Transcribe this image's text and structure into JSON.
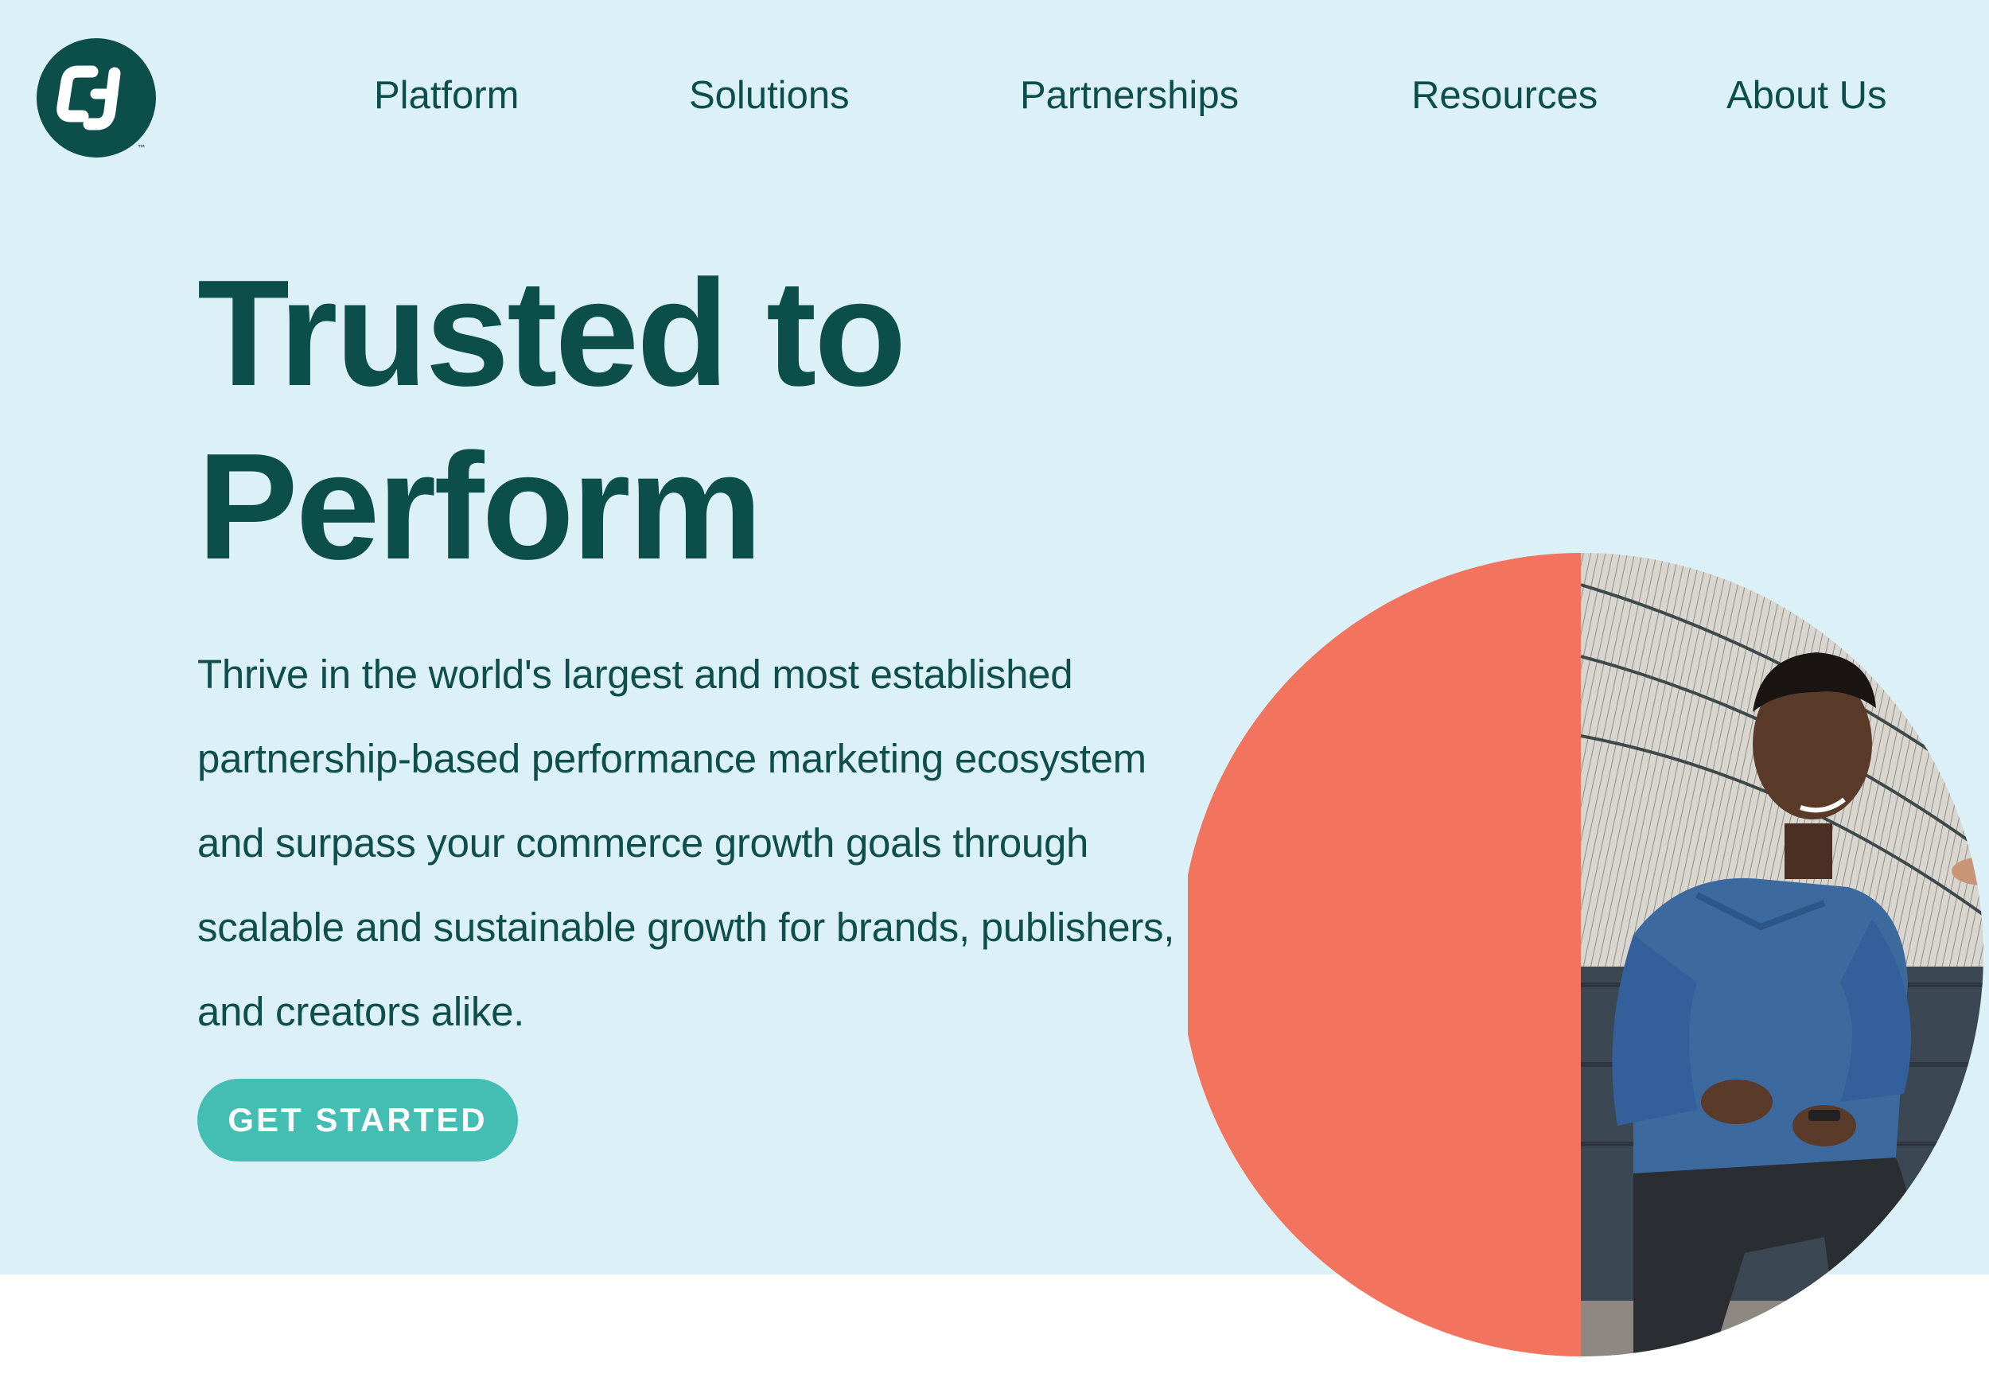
{
  "brand": {
    "logo_alt": "CJ",
    "trademark": "™",
    "color_primary": "#0b4e4a",
    "color_accent": "#44bdb3",
    "color_coral": "#f2745e",
    "color_hero_bg": "#dcf0f8"
  },
  "nav": {
    "items": [
      {
        "label": "Platform"
      },
      {
        "label": "Solutions"
      },
      {
        "label": "Partnerships"
      },
      {
        "label": "Resources"
      },
      {
        "label": "About Us"
      }
    ]
  },
  "hero": {
    "headline_lines": [
      "Trusted to",
      "Perform"
    ],
    "body_lines": [
      "Thrive in the world's largest and most established",
      "partnership-based performance marketing ecosystem",
      "and surpass your commerce growth goals through",
      "scalable and sustainable growth for brands, publishers,",
      "and creators alike."
    ],
    "cta_label": "GET STARTED",
    "image_description_icon": "person-photo"
  }
}
